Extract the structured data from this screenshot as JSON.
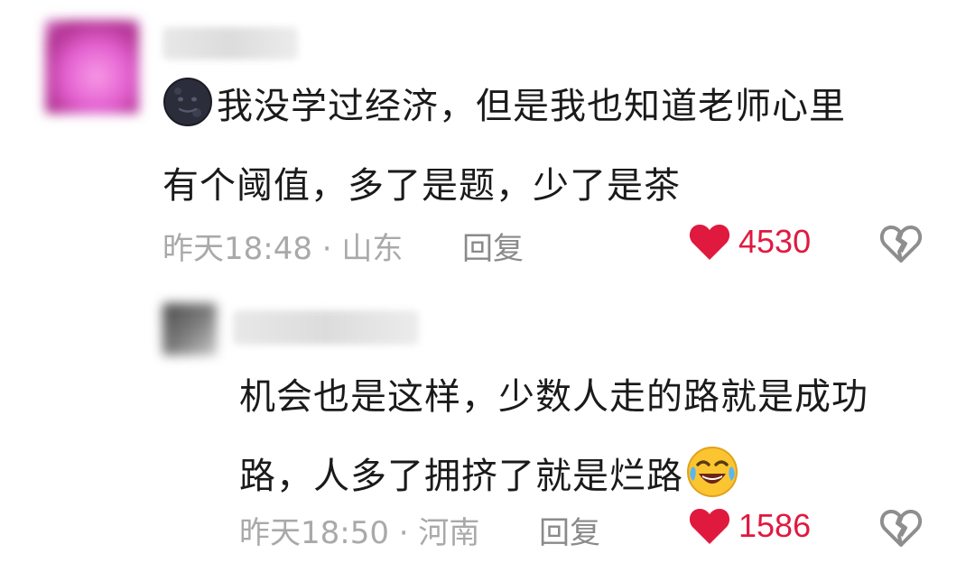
{
  "comments": [
    {
      "text_line1": "我没学过经济，但是我也知道老师心里",
      "text_line2": "有个阈值，多了是题，少了是茶",
      "meta": "昨天18:48 · 山东",
      "reply_label": "回复",
      "likes": "4530",
      "leading_emoji": "new-moon-face-icon"
    },
    {
      "text_line1": "机会也是这样，少数人走的路就是成功",
      "text_line2": "路，人多了拥挤了就是烂路",
      "meta": "昨天18:50 · 河南",
      "reply_label": "回复",
      "likes": "1586",
      "trailing_emoji": "rolling-laughing-icon"
    }
  ],
  "colors": {
    "like_red": "#e0193f",
    "meta_gray": "#a9a9a9",
    "text": "#1a1a1a"
  }
}
